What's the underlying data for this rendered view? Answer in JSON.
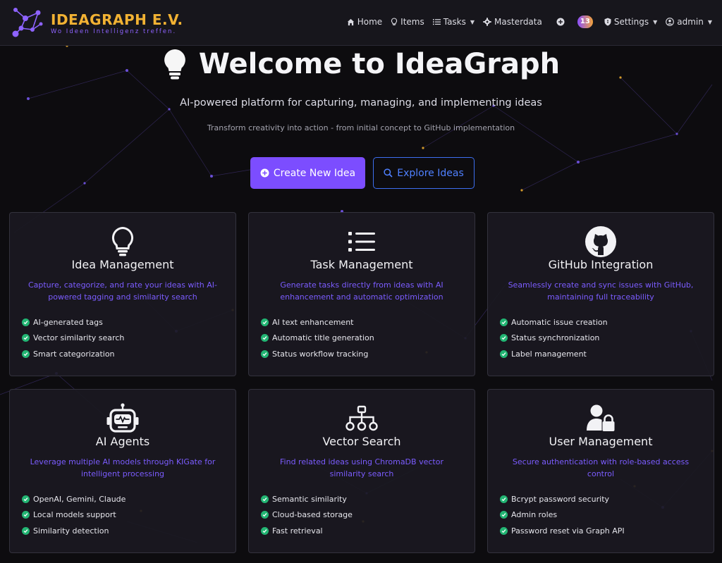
{
  "brand": {
    "title": "IDEAGRAPH E.V.",
    "tagline": "Wo Ideen Intelligenz treffen."
  },
  "nav": {
    "home": "Home",
    "items": "Items",
    "tasks": "Tasks",
    "masterdata": "Masterdata",
    "notification_count": "13",
    "settings": "Settings",
    "user": "admin"
  },
  "hero": {
    "title": "Welcome to IdeaGraph",
    "subtitle": "AI-powered platform for capturing, managing, and implementing ideas",
    "tagline": "Transform creativity into action - from initial concept to GitHub implementation",
    "primary_button": "Create New Idea",
    "secondary_button": "Explore Ideas"
  },
  "cards": [
    {
      "icon": "lightbulb-icon",
      "title": "Idea Management",
      "description": "Capture, categorize, and rate your ideas with AI-powered tagging and similarity search",
      "features": [
        "AI-generated tags",
        "Vector similarity search",
        "Smart categorization"
      ]
    },
    {
      "icon": "list-icon",
      "title": "Task Management",
      "description": "Generate tasks directly from ideas with AI enhancement and automatic optimization",
      "features": [
        "AI text enhancement",
        "Automatic title generation",
        "Status workflow tracking"
      ]
    },
    {
      "icon": "github-icon",
      "title": "GitHub Integration",
      "description": "Seamlessly create and sync issues with GitHub, maintaining full traceability",
      "features": [
        "Automatic issue creation",
        "Status synchronization",
        "Label management"
      ]
    },
    {
      "icon": "robot-icon",
      "title": "AI Agents",
      "description": "Leverage multiple AI models through KIGate for intelligent processing",
      "features": [
        "OpenAI, Gemini, Claude",
        "Local models support",
        "Similarity detection"
      ]
    },
    {
      "icon": "sitemap-icon",
      "title": "Vector Search",
      "description": "Find related ideas using ChromaDB vector similarity search",
      "features": [
        "Semantic similarity",
        "Cloud-based storage",
        "Fast retrieval"
      ]
    },
    {
      "icon": "user-lock-icon",
      "title": "User Management",
      "description": "Secure authentication with role-based access control",
      "features": [
        "Bcrypt password security",
        "Admin roles",
        "Password reset via Graph API"
      ]
    }
  ],
  "colors": {
    "brand_gold": "#f2b233",
    "accent_purple": "#7c4dff",
    "outline_blue": "#3d6ff0",
    "check_green": "#22b573",
    "background": "#0d0c0f"
  }
}
